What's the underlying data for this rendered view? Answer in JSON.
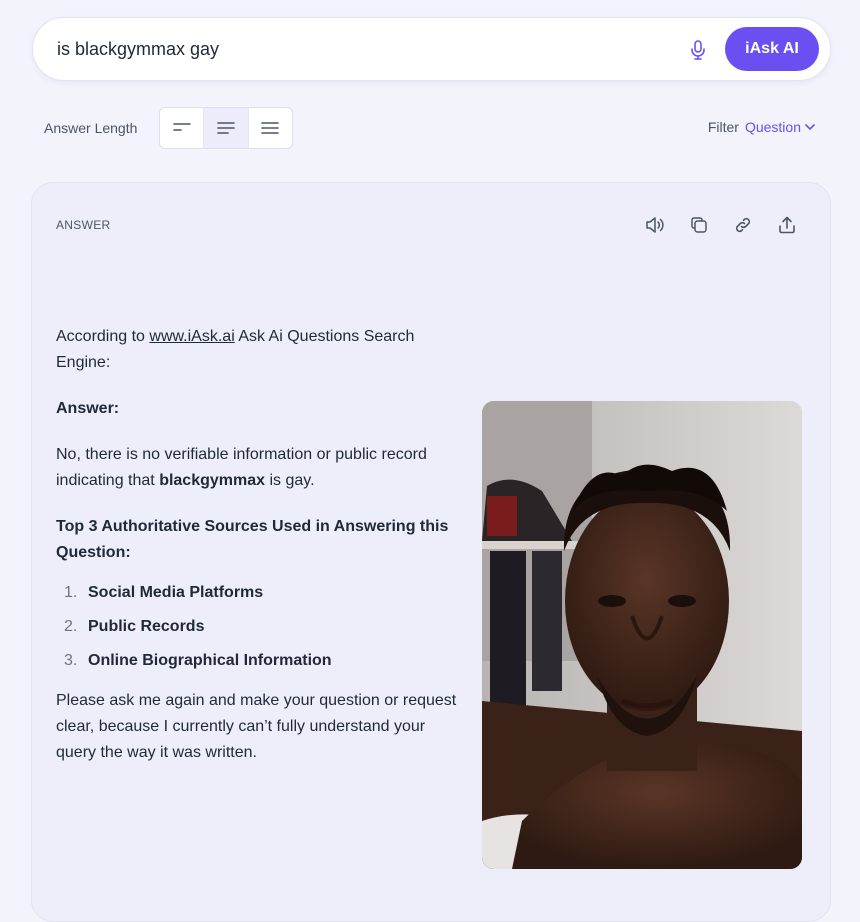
{
  "search": {
    "query": "is blackgymmax gay",
    "button_label": "iAsk AI"
  },
  "controls": {
    "answer_length_label": "Answer Length",
    "filter_label": "Filter",
    "filter_value": "Question"
  },
  "answer": {
    "tag": "ANSWER",
    "intro_prefix": "According to ",
    "intro_link": "www.iAsk.ai",
    "intro_suffix": " Ask Ai Questions Search Engine:",
    "answer_heading": "Answer:",
    "body_prefix": "No, there is no verifiable information or public record indicating that ",
    "body_bold": "blackgymmax",
    "body_suffix": " is gay.",
    "sources_heading": "Top 3 Authoritative Sources Used in Answering this Question:",
    "sources": [
      {
        "num": "1.",
        "label": "Social Media Platforms"
      },
      {
        "num": "2.",
        "label": "Public Records"
      },
      {
        "num": "3.",
        "label": "Online Biographical Information"
      }
    ],
    "closing": "Please ask me again and make your question or request clear, because I currently can’t fully understand your query the way it was written."
  },
  "colors": {
    "accent": "#6c4ff0",
    "page_bg": "#f3f3fc",
    "card_bg": "#eeeefa"
  }
}
